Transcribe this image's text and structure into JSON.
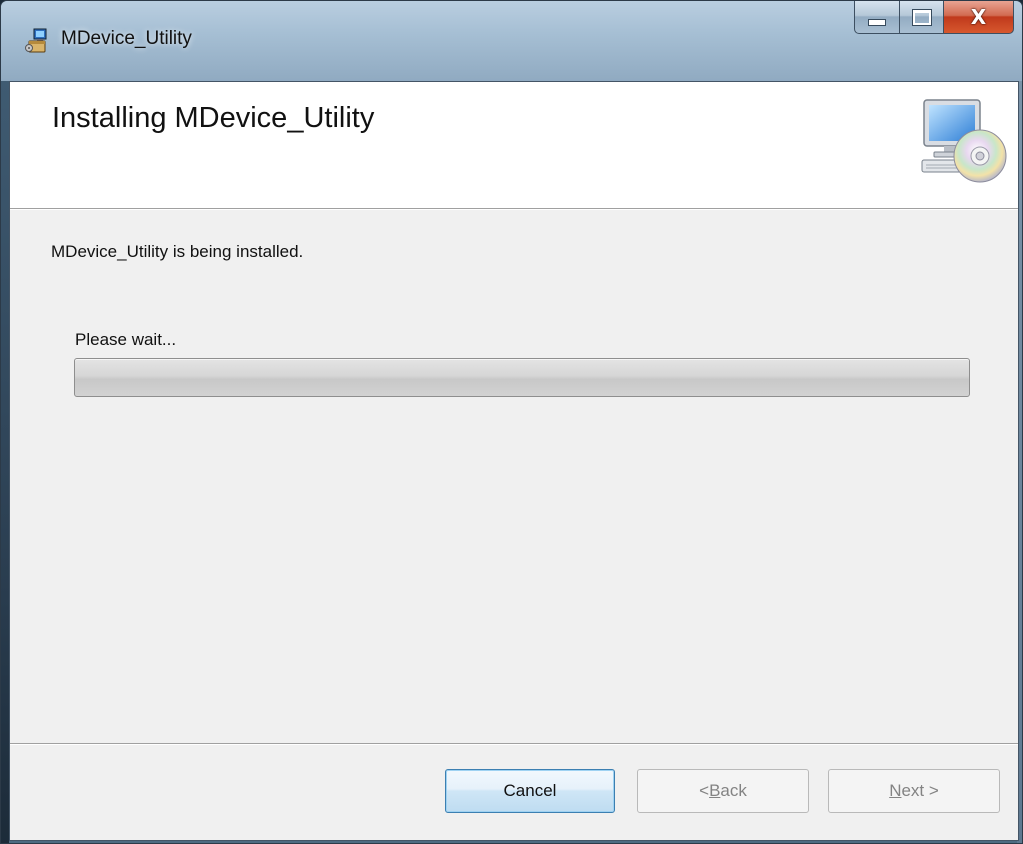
{
  "window": {
    "title": "MDevice_Utility",
    "app_icon": "installer-icon",
    "caption_buttons": {
      "minimize_icon": "minimize-icon",
      "maximize_icon": "maximize-icon",
      "close_glyph": "X"
    }
  },
  "banner": {
    "title": "Installing MDevice_Utility",
    "graphic": "computer-with-cd-icon"
  },
  "main": {
    "status_text": "MDevice_Utility is being installed.",
    "progress_label": "Please wait...",
    "progress_fraction": 0
  },
  "footer": {
    "cancel_label": "Cancel",
    "back_prefix": "< ",
    "back_mnemonic": "B",
    "back_rest": "ack",
    "next_mnemonic": "N",
    "next_rest": "ext >"
  },
  "colors": {
    "client_background": "#f0f0f0",
    "banner_background": "#ffffff",
    "close_button": "#c0391c"
  }
}
